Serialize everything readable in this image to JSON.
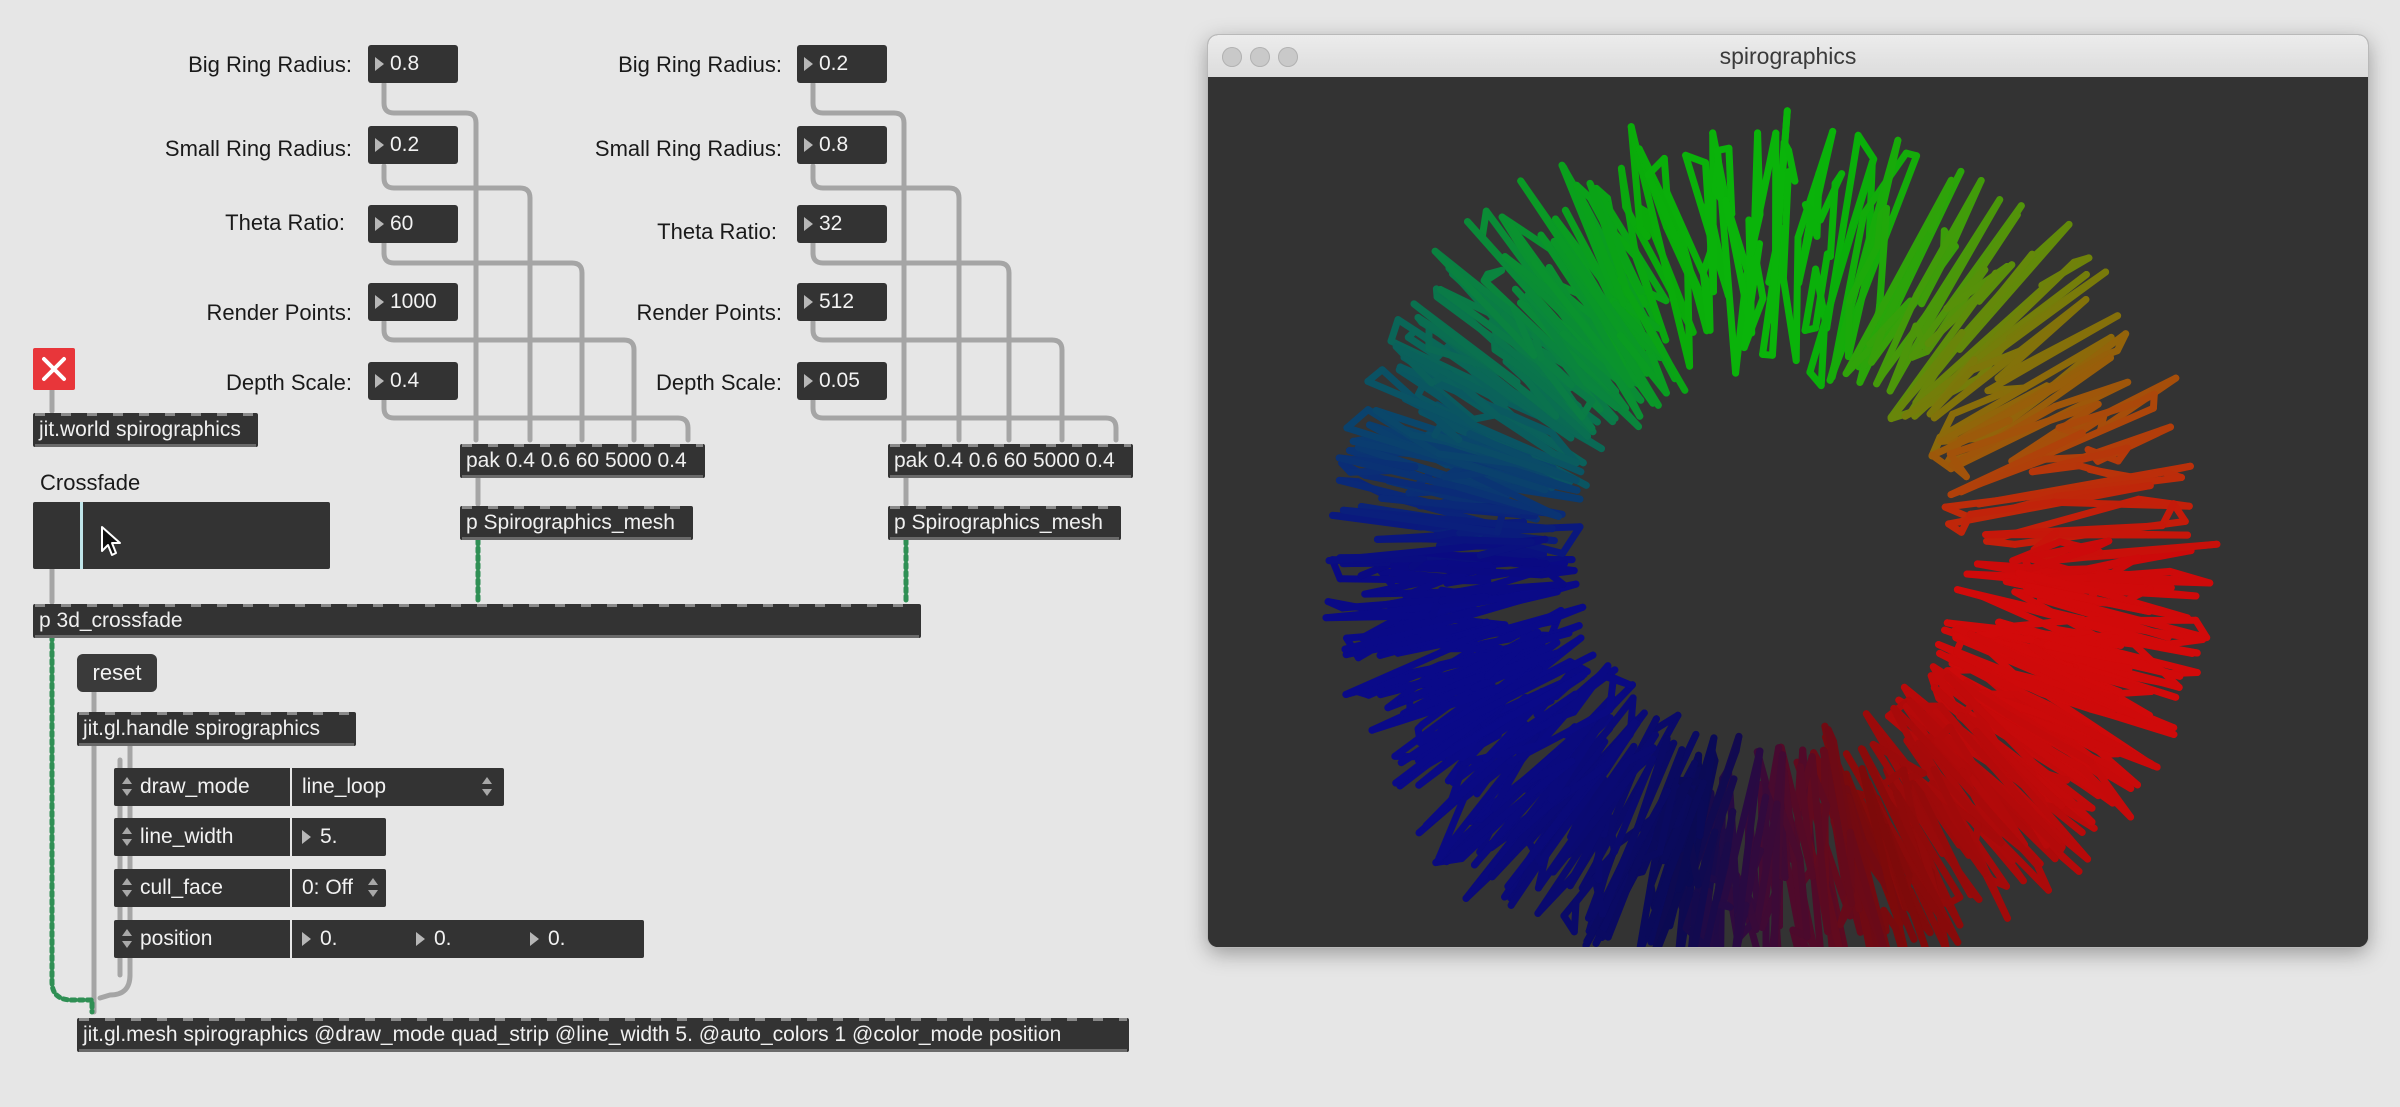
{
  "patcher": {
    "left_panel": {
      "big_ring_radius": {
        "label": "Big Ring Radius:",
        "value": "0.8"
      },
      "small_ring_radius": {
        "label": "Small Ring Radius:",
        "value": "0.2"
      },
      "theta_ratio": {
        "label": "Theta Ratio:",
        "value": "60"
      },
      "render_points": {
        "label": "Render Points:",
        "value": "1000"
      },
      "depth_scale": {
        "label": "Depth Scale:",
        "value": "0.4"
      },
      "pak": "pak 0.4 0.6 60 5000 0.4",
      "mesh_sub": "p Spirographics_mesh"
    },
    "right_panel": {
      "big_ring_radius": {
        "label": "Big Ring Radius:",
        "value": "0.2"
      },
      "small_ring_radius": {
        "label": "Small Ring Radius:",
        "value": "0.8"
      },
      "theta_ratio": {
        "label": "Theta Ratio:",
        "value": "32"
      },
      "render_points": {
        "label": "Render Points:",
        "value": "512"
      },
      "depth_scale": {
        "label": "Depth Scale:",
        "value": "0.05"
      },
      "pak": "pak 0.4 0.6 60 5000 0.4",
      "mesh_sub": "p Spirographics_mesh"
    },
    "jit_world": "jit.world spirographics",
    "crossfade_label": "Crossfade",
    "crossfade_value": 0.16,
    "crossfade_obj": "p 3d_crossfade",
    "reset_label": "reset",
    "handle_obj": "jit.gl.handle spirographics",
    "attrs": {
      "draw_mode": {
        "name": "draw_mode",
        "value": "line_loop"
      },
      "line_width": {
        "name": "line_width",
        "value": "5."
      },
      "cull_face": {
        "name": "cull_face",
        "value": "0: Off"
      },
      "position": {
        "name": "position",
        "values": [
          "0.",
          "0.",
          "0."
        ]
      }
    },
    "mesh_obj": "jit.gl.mesh spirographics @draw_mode quad_strip @line_width 5. @auto_colors 1 @color_mode position"
  },
  "window": {
    "title": "spirographics"
  },
  "colors": {
    "patch_bg": "#e6e6e6",
    "object_bg": "#333333",
    "toggle_red": "#e8363a",
    "cord_gray": "#a5a5a5",
    "cord_signal": "#2f8f54",
    "render_bg": "#333333"
  }
}
